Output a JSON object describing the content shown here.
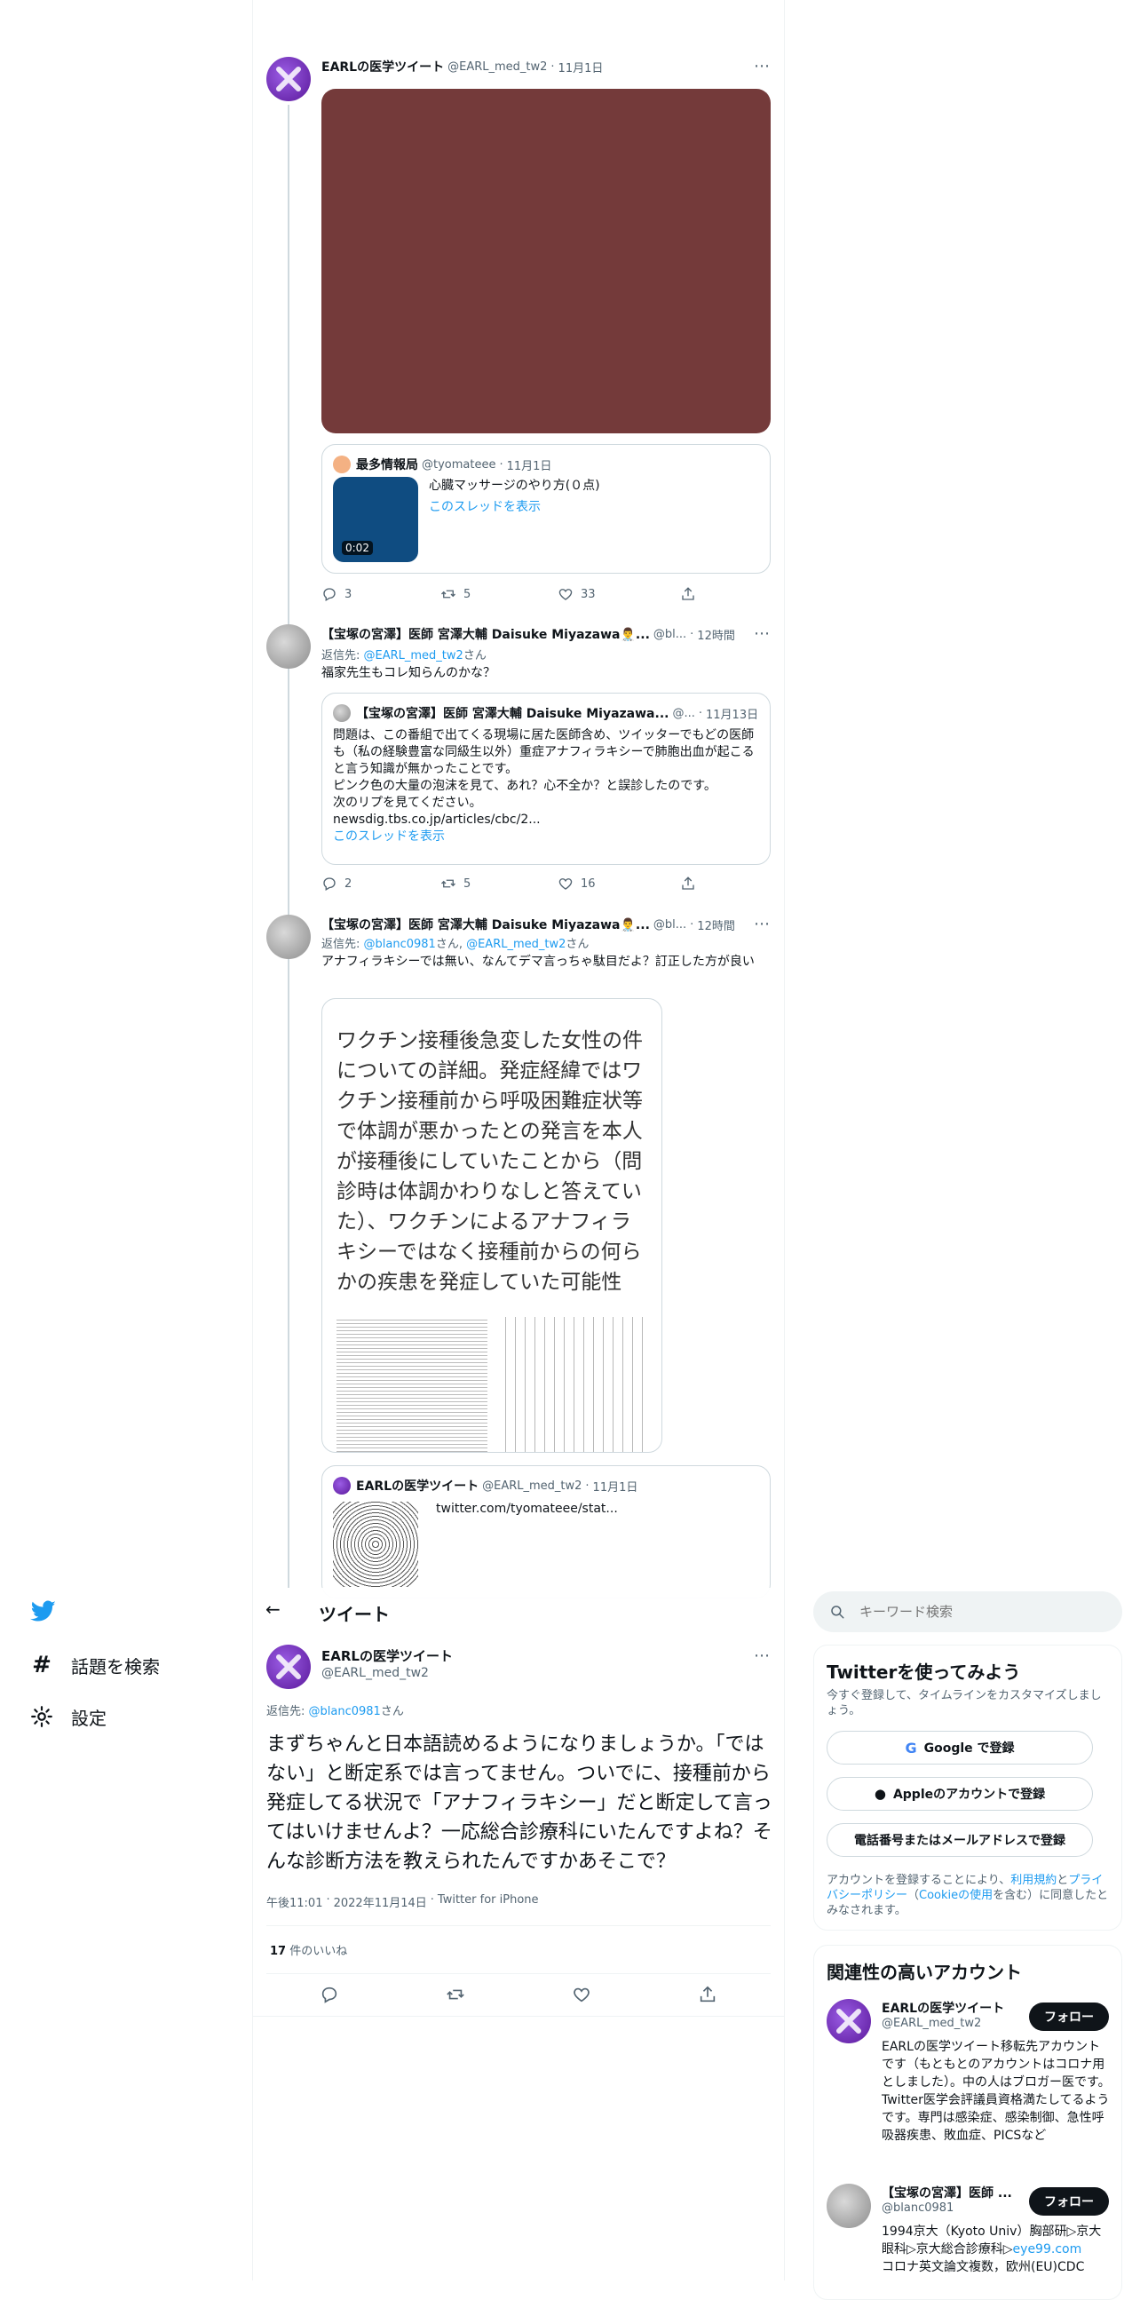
{
  "nav": {
    "explore_label": "話題を検索",
    "settings_label": "設定"
  },
  "header": {
    "title": "ツイート"
  },
  "search": {
    "placeholder": "キーワード検索"
  },
  "tweet1": {
    "name": "EARLの医学ツイート",
    "handle": "@EARL_med_tw2",
    "sep": "·",
    "date": "11月1日",
    "quote": {
      "name": "最多情報局",
      "handle": "@tyomateee",
      "sep": "·",
      "date": "11月1日",
      "text": "心臓マッサージのやり方(０点)",
      "thread_link": "このスレッドを表示",
      "duration": "0:02"
    },
    "replies": "3",
    "retweets": "5",
    "likes": "33"
  },
  "tweet2": {
    "name": "【宝塚の宮澤】医師 宮澤大輔 Daisuke Miyazawa👨‍⚕️...",
    "handle": "@bl...",
    "sep": "·",
    "time": "12時間",
    "reply_prefix": "返信先: ",
    "reply_to": "@EARL_med_tw2",
    "reply_suffix": "さん",
    "text": "福家先生もコレ知らんのかな？",
    "quote": {
      "name": "【宝塚の宮澤】医師 宮澤大輔 Daisuke Miyazawa...",
      "handle": "@...",
      "sep": "·",
      "date": "11月13日",
      "text1": "問題は、この番組で出てくる現場に居た医師含め、ツイッターでもどの医師も（私の経験豊富な同級生以外）重症アナフィラキシーで肺胞出血が起こると言う知識が無かったことです。",
      "text2": "ピンク色の大量の泡沫を見て、あれ？心不全か？と誤診したのです。",
      "text3": "次のリプを見てください。",
      "url": "newsdig.tbs.co.jp/articles/cbc/2...",
      "thread_link": "このスレッドを表示"
    },
    "replies": "2",
    "retweets": "5",
    "likes": "16"
  },
  "tweet3": {
    "name": "【宝塚の宮澤】医師 宮澤大輔 Daisuke Miyazawa👨‍⚕️...",
    "handle": "@bl...",
    "sep": "·",
    "time": "12時間",
    "reply_prefix": "返信先: ",
    "reply_to1": "@blanc0981",
    "reply_mid": "さん, ",
    "reply_to2": "@EARL_med_tw2",
    "reply_suffix": "さん",
    "text": "アナフィラキシーでは無い、なんてデマ言っちゃ駄目だよ？訂正した方が良い",
    "image_text": "ワクチン接種後急変した女性の件についての詳細。発症経緯ではワクチン接種前から呼吸困難症状等で体調が悪かったとの発言を本人が接種後にしていたことから（問診時は体調かわりなしと答えていた）、ワクチンによるアナフィラキシーではなく接種前からの何らかの疾患を発症していた可能性",
    "quote": {
      "name": "EARLの医学ツイート",
      "handle": "@EARL_med_tw2",
      "sep": "·",
      "date": "11月1日",
      "text": "twitter.com/tyomateee/stat..."
    }
  },
  "main_tweet": {
    "name": "EARLの医学ツイート",
    "handle": "@EARL_med_tw2",
    "reply_prefix": "返信先: ",
    "reply_to": "@blanc0981",
    "reply_suffix": "さん",
    "text": "まずちゃんと日本語読めるようになりましょうか。「ではない」と断定系では言ってません。ついでに、接種前から発症してる状況で「アナフィラキシー」だと断定して言ってはいけませんよ？一応総合診療科にいたんですよね？そんな診断方法を教えられたんですかあそこで？",
    "time": "午後11:01",
    "sep1": "·",
    "date": "2022年11月14日",
    "sep2": "·",
    "source": "Twitter for iPhone",
    "likes_count": "17",
    "likes_label": " 件のいいね"
  },
  "signup": {
    "title": "Twitterを使ってみよう",
    "desc": "今すぐ登録して、タイムラインをカスタマイズしましょう。",
    "google": "Google で登録",
    "apple": "Appleのアカウントで登録",
    "phone": "電話番号またはメールアドレスで登録",
    "legal1": "アカウントを登録することにより、",
    "legal_terms": "利用規約",
    "legal2": "と",
    "legal_privacy": "プライバシーポリシー",
    "legal3": "（",
    "legal_cookie": "Cookieの使用",
    "legal4": "を含む）に同意したとみなされます。"
  },
  "related": {
    "title": "関連性の高いアカウント",
    "accounts": [
      {
        "name": "EARLの医学ツイート",
        "handle": "@EARL_med_tw2",
        "follow": "フォロー",
        "bio": "EARLの医学ツイート移転先アカウントです（もともとのアカウントはコロナ用としました）。中の人はブロガー医です。Twitter医学会評議員資格満たしてるようです。専門は感染症、感染制御、急性呼吸器疾患、敗血症、PICSなど"
      },
      {
        "name": "【宝塚の宮澤】医師 ...",
        "handle": "@blanc0981",
        "follow": "フォロー",
        "bio1": "1994京大（Kyoto Univ）胸部研▷京大眼科▷京大総合診療科▷",
        "bio_link": "eye99.com",
        "bio2": "コロナ英文論文複数，欧州(EU)CDC"
      }
    ]
  },
  "colors": {
    "accent": "#1d9bf0",
    "text": "#0f1419",
    "muted": "#536471",
    "border": "#cfd9de",
    "image1": "#743a3a",
    "video_thumb": "#0f4c81"
  }
}
